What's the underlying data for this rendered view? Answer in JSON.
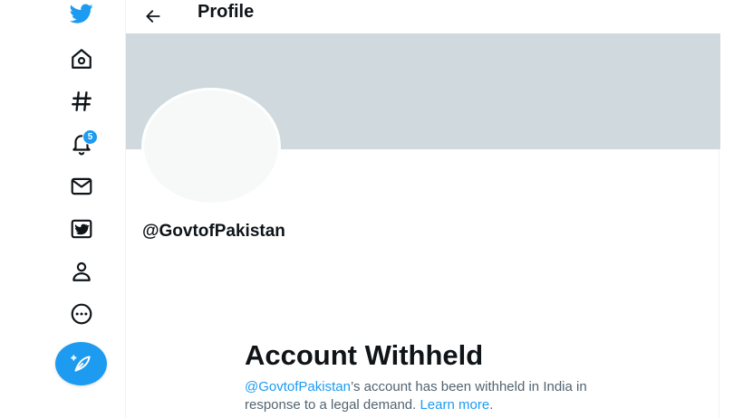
{
  "sidebar": {
    "items": [
      {
        "icon": "twitter-bird-icon"
      },
      {
        "icon": "home-icon"
      },
      {
        "icon": "hashtag-explore-icon"
      },
      {
        "icon": "bell-notifications-icon",
        "badge": "5"
      },
      {
        "icon": "envelope-messages-icon"
      },
      {
        "icon": "twitter-blue-icon"
      },
      {
        "icon": "person-profile-icon"
      },
      {
        "icon": "more-circle-icon"
      }
    ],
    "compose_icon": "feather-compose-icon"
  },
  "header": {
    "title": "Profile",
    "back_icon": "arrow-left-icon"
  },
  "profile": {
    "handle": "@GovtofPakistan"
  },
  "withheld": {
    "title": "Account Withheld",
    "handle_link": "@GovtofPakistan",
    "text_1": "’s account has been withheld in India in response to a legal demand.",
    "learn_more": "Learn more",
    "period": "."
  },
  "colors": {
    "accent": "#1d9bf0",
    "banner": "#cfd9de",
    "avatar": "#f7f9f9"
  }
}
